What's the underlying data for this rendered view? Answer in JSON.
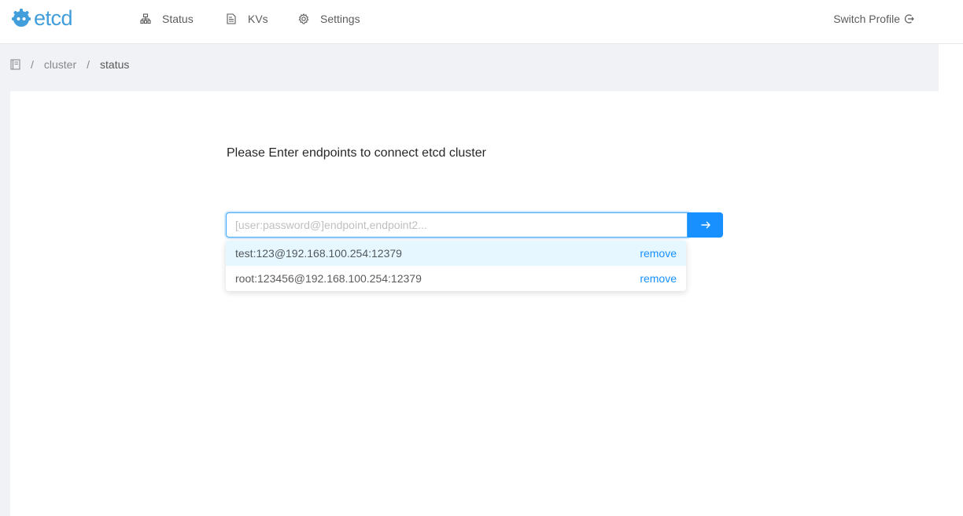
{
  "app": {
    "logo_text": "etcd",
    "brand_color": "#419eda",
    "accent_color": "#1890ff"
  },
  "nav": {
    "items": [
      {
        "label": "Status",
        "icon": "cluster-icon"
      },
      {
        "label": "KVs",
        "icon": "file-icon"
      },
      {
        "label": "Settings",
        "icon": "gear-icon"
      }
    ],
    "switch_profile": "Switch Profile"
  },
  "breadcrumb": {
    "icon": "book-icon",
    "items": [
      "cluster",
      "status"
    ],
    "separator": "/"
  },
  "main": {
    "prompt": "Please Enter endpoints to connect etcd cluster",
    "input": {
      "value": "",
      "placeholder": "[user:password@]endpoint,endpoint2..."
    },
    "submit_icon": "arrow-right-icon",
    "suggestions": [
      {
        "endpoint": "test:123@192.168.100.254:12379",
        "action": "remove",
        "active": true
      },
      {
        "endpoint": "root:123456@192.168.100.254:12379",
        "action": "remove",
        "active": false
      }
    ]
  }
}
